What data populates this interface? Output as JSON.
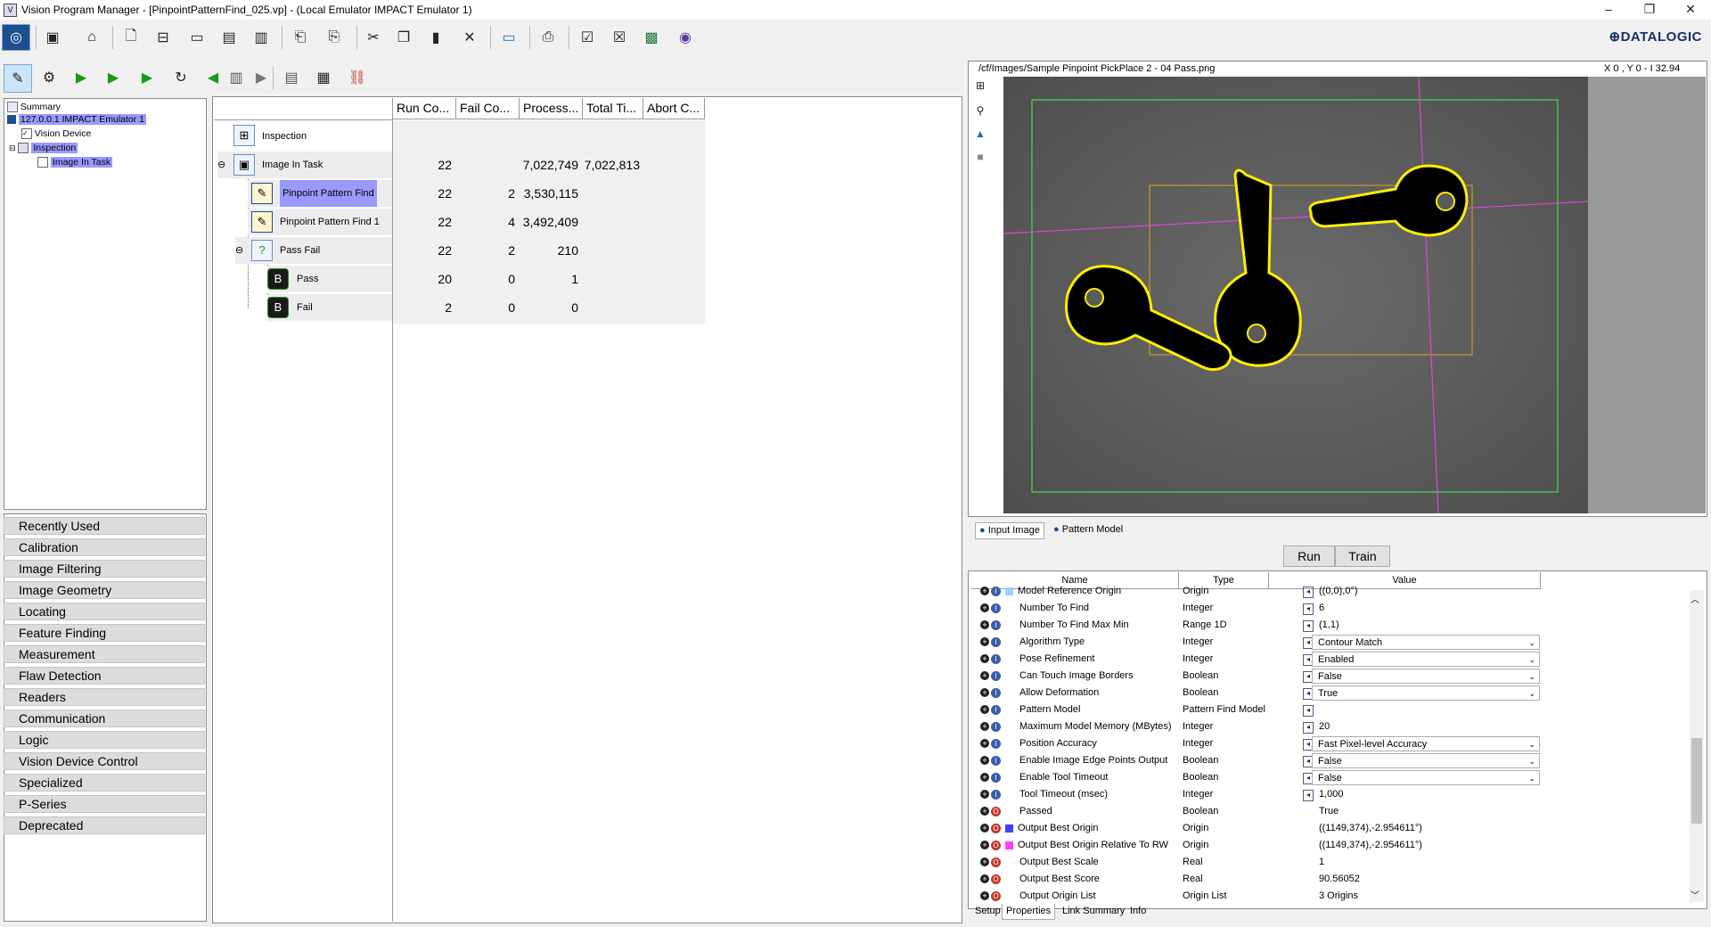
{
  "window": {
    "title": "Vision Program Manager - [PinpointPatternFind_025.vp] - (Local Emulator IMPACT Emulator 1)",
    "controls": [
      "–",
      "❐",
      "✕"
    ]
  },
  "brand": "⊕DATALOGIC",
  "toolbar1": {
    "icons": [
      "vision-device-icon",
      "stop-icon",
      "home-icon",
      "new-file-icon",
      "open-icon",
      "folder-icon",
      "save-icon",
      "save-all-icon",
      "import-icon",
      "export-icon",
      "cut-icon",
      "copy-icon",
      "paste-icon",
      "delete-icon",
      "monitor-icon",
      "print-icon",
      "checklist-icon",
      "checklist2-icon",
      "fingerprint-icon",
      "help-icon"
    ]
  },
  "toolbar2": {
    "icons": [
      "edit-mode-icon",
      "settings-icon",
      "run-icon",
      "run-once-icon",
      "run-n-icon",
      "loop-icon",
      "prev-icon",
      "film-icon",
      "next-icon",
      "stop-image-icon",
      "counter-icon",
      "link-icon"
    ]
  },
  "tree": {
    "items": [
      {
        "label": "Summary",
        "selected": false
      },
      {
        "label": "127.0.0.1 IMPACT Emulator 1",
        "selected": true
      },
      {
        "label": "Vision Device",
        "selected": false
      },
      {
        "label": "Inspection",
        "selected": true
      },
      {
        "label": "Image In Task",
        "selected": true
      }
    ]
  },
  "categories": [
    "Recently Used",
    "Calibration",
    "Image Filtering",
    "Image Geometry",
    "Locating",
    "Feature Finding",
    "Measurement",
    "Flaw Detection",
    "Readers",
    "Communication",
    "Logic",
    "Vision Device Control",
    "Specialized",
    "P-Series",
    "Deprecated"
  ],
  "grid": {
    "headers": [
      "Run Co...",
      "Fail Co...",
      "Process...",
      "Total Ti...",
      "Abort C..."
    ],
    "rows": [
      {
        "name": "Inspection",
        "run": "",
        "fail": "",
        "process": "",
        "total": "",
        "abort": ""
      },
      {
        "name": "Image In Task",
        "run": "22",
        "fail": "",
        "process": "7,022,749",
        "total": "7,022,813",
        "abort": ""
      },
      {
        "name": "Pinpoint Pattern Find",
        "run": "22",
        "fail": "2",
        "process": "3,530,115",
        "total": "",
        "abort": ""
      },
      {
        "name": "Pinpoint Pattern Find 1",
        "run": "22",
        "fail": "4",
        "process": "3,492,409",
        "total": "",
        "abort": ""
      },
      {
        "name": "Pass Fail",
        "run": "22",
        "fail": "2",
        "process": "210",
        "total": "",
        "abort": ""
      },
      {
        "name": "Pass",
        "run": "20",
        "fail": "0",
        "process": "1",
        "total": "",
        "abort": ""
      },
      {
        "name": "Fail",
        "run": "2",
        "fail": "0",
        "process": "0",
        "total": "",
        "abort": ""
      }
    ]
  },
  "viewer": {
    "path": "/cf/Images/Sample Pinpoint PickPlace 2 - 04 Pass.png",
    "coords": "X 0 , Y 0  -  I 32.94",
    "tabs": [
      "Input Image",
      "Pattern Model"
    ]
  },
  "actions": {
    "run": "Run",
    "train": "Train"
  },
  "props": {
    "headers": [
      "Name",
      "Type",
      "Value"
    ],
    "rows": [
      {
        "name": "Model Reference Origin",
        "type": "Origin",
        "value": "((0,0),0°)",
        "io": "in",
        "mode": "text",
        "swatch": "#9ad0ff"
      },
      {
        "name": "Number To Find",
        "type": "Integer",
        "value": "6",
        "io": "in",
        "mode": "text"
      },
      {
        "name": "Number To Find Max Min",
        "type": "Range 1D",
        "value": "(1,1)",
        "io": "in",
        "mode": "text"
      },
      {
        "name": "Algorithm Type",
        "type": "Integer",
        "value": "Contour Match",
        "io": "in",
        "mode": "dropdown"
      },
      {
        "name": "Pose Refinement",
        "type": "Integer",
        "value": "Enabled",
        "io": "in",
        "mode": "dropdown"
      },
      {
        "name": "Can Touch Image Borders",
        "type": "Boolean",
        "value": "False",
        "io": "in",
        "mode": "dropdown"
      },
      {
        "name": "Allow Deformation",
        "type": "Boolean",
        "value": "True",
        "io": "in",
        "mode": "dropdown"
      },
      {
        "name": "Pattern Model",
        "type": "Pattern Find Model",
        "value": "",
        "io": "in",
        "mode": "text"
      },
      {
        "name": "Maximum Model Memory (MBytes)",
        "type": "Integer",
        "value": "20",
        "io": "in",
        "mode": "text"
      },
      {
        "name": "Position Accuracy",
        "type": "Integer",
        "value": "Fast Pixel-level Accuracy",
        "io": "in",
        "mode": "dropdown"
      },
      {
        "name": "Enable Image Edge Points Output",
        "type": "Boolean",
        "value": "False",
        "io": "in",
        "mode": "dropdown"
      },
      {
        "name": "Enable Tool Timeout",
        "type": "Boolean",
        "value": "False",
        "io": "in",
        "mode": "dropdown"
      },
      {
        "name": "Tool Timeout (msec)",
        "type": "Integer",
        "value": "1,000",
        "io": "in",
        "mode": "text"
      },
      {
        "name": "Passed",
        "type": "Boolean",
        "value": "True",
        "io": "out",
        "mode": "plain"
      },
      {
        "name": "Output Best Origin",
        "type": "Origin",
        "value": "((1149,374),-2.954611°)",
        "io": "out",
        "mode": "plain",
        "swatch": "#4040ff"
      },
      {
        "name": "Output Best Origin Relative To RW",
        "type": "Origin",
        "value": "((1149,374),-2.954611°)",
        "io": "out",
        "mode": "plain",
        "swatch": "#ff40ff"
      },
      {
        "name": "Output Best Scale",
        "type": "Real",
        "value": "1",
        "io": "out",
        "mode": "plain"
      },
      {
        "name": "Output Best Score",
        "type": "Real",
        "value": "90.56052",
        "io": "out",
        "mode": "plain"
      },
      {
        "name": "Output Origin List",
        "type": "Origin List",
        "value": "3 Origins",
        "io": "out",
        "mode": "plain"
      }
    ]
  },
  "bottom_tabs": [
    "Setup",
    "Properties",
    "Link Summary",
    "Info"
  ],
  "colors": {
    "selection": "#9999ff",
    "contour": "#ffee00",
    "roi": "#44dd44",
    "axis": "#dd44dd",
    "io_in": "#3a5ea8",
    "io_out": "#c0392b"
  }
}
